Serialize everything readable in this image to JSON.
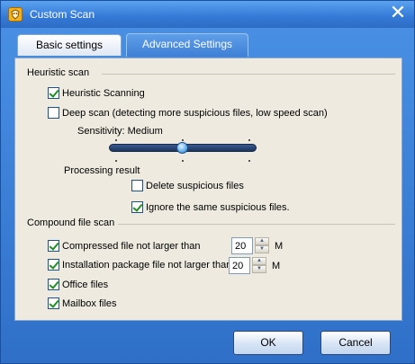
{
  "window": {
    "title": "Custom Scan",
    "close_glyph": "✕",
    "icon": "shield-icon"
  },
  "tabs": [
    {
      "label": "Basic settings",
      "selected": false
    },
    {
      "label": "Advanced Settings",
      "selected": true
    }
  ],
  "heuristic": {
    "section_title": "Heuristic scan",
    "heuristic_scanning": {
      "label": "Heuristic Scanning",
      "checked": true
    },
    "deep_scan": {
      "label": "Deep scan (detecting more suspicious files, low speed scan)",
      "checked": false
    },
    "sensitivity_label": "Sensitivity: Medium",
    "sensitivity_level": 0.5,
    "processing_title": "Processing result",
    "delete_suspicious": {
      "label": "Delete suspicious files",
      "checked": false
    },
    "ignore_same": {
      "label": "Ignore the same suspicious files.",
      "checked": true
    }
  },
  "compound": {
    "section_title": "Compound file scan",
    "compressed": {
      "label": "Compressed file not larger than",
      "checked": true,
      "value": "20",
      "unit": "M"
    },
    "installation": {
      "label": "Installation package file not larger than",
      "checked": true,
      "value": "20",
      "unit": "M"
    },
    "office": {
      "label": "Office files",
      "checked": true
    },
    "mailbox": {
      "label": "Mailbox files",
      "checked": true
    }
  },
  "buttons": {
    "ok": "OK",
    "cancel": "Cancel"
  },
  "colors": {
    "window_blue": "#3b7fd4",
    "panel_bg": "#eeeae0",
    "check_green": "#1e8f1e"
  }
}
